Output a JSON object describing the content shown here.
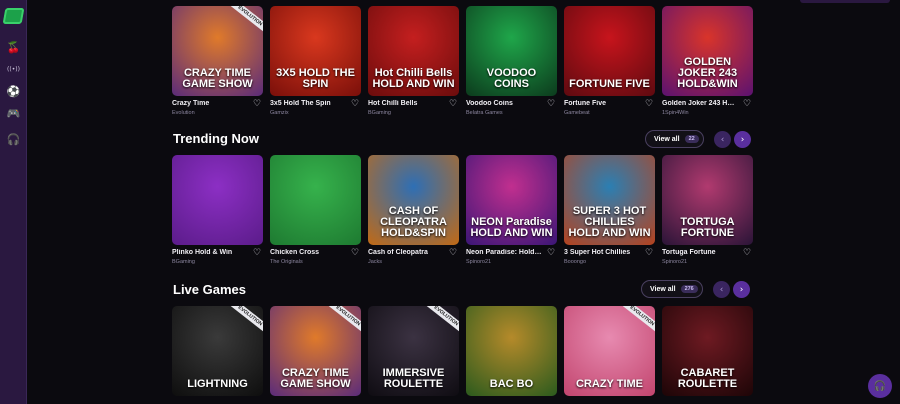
{
  "nav": {
    "icons": [
      "cherries-icon",
      "live-broadcast-icon",
      "soccer-ball-icon",
      "gamepad-icon",
      "headset-icon"
    ],
    "glyphs": [
      "🍒",
      "((•))",
      "⚽",
      "🎮",
      "🎧"
    ]
  },
  "sections": {
    "top": {
      "tiles": [
        {
          "title": "Crazy Time",
          "provider": "Evolution",
          "art": "CRAZY TIME GAME SHOW",
          "ribbon": "EVOLUTION",
          "bg1": "#e07a2a",
          "bg2": "#5a2b7a"
        },
        {
          "title": "3x5 Hold The Spin",
          "provider": "Gamzix",
          "art": "3X5 HOLD THE SPIN",
          "ribbon": "",
          "bg1": "#d9381e",
          "bg2": "#7a0f0a"
        },
        {
          "title": "Hot Chilli Bells",
          "provider": "BGaming",
          "art": "Hot Chilli Bells HOLD AND WIN",
          "ribbon": "",
          "bg1": "#c41f1f",
          "bg2": "#6b0c0c"
        },
        {
          "title": "Voodoo Coins",
          "provider": "Belatra Games",
          "art": "VOODOO COINS",
          "ribbon": "",
          "bg1": "#1fa64a",
          "bg2": "#0c3b1d"
        },
        {
          "title": "Fortune Five",
          "provider": "Gamebeat",
          "art": "FORTUNE FIVE",
          "ribbon": "",
          "bg1": "#c7141c",
          "bg2": "#5e0a10"
        },
        {
          "title": "Golden Joker 243 Hol…",
          "provider": "1Spin4Win",
          "art": "GOLDEN JOKER 243 HOLD&WIN",
          "ribbon": "",
          "bg1": "#d9342a",
          "bg2": "#5b1270"
        }
      ]
    },
    "trending": {
      "heading": "Trending Now",
      "view_all": "View all",
      "count": "22",
      "tiles": [
        {
          "title": "Plinko Hold & Win",
          "provider": "BGaming",
          "art": "",
          "ribbon": "",
          "bg1": "#8c2fc4",
          "bg2": "#5b1c8a"
        },
        {
          "title": "Chicken Cross",
          "provider": "The Originals",
          "art": "",
          "ribbon": "",
          "bg1": "#36b24c",
          "bg2": "#1e7a31"
        },
        {
          "title": "Cash of Cleopatra",
          "provider": "Jacks",
          "art": "CASH OF CLEOPATRA HOLD&SPIN",
          "ribbon": "",
          "bg1": "#2e6fb5",
          "bg2": "#c26a15"
        },
        {
          "title": "Neon Paradise: Hold a…",
          "provider": "Spinoro21",
          "art": "NEON Paradise HOLD AND WIN",
          "ribbon": "",
          "bg1": "#c12f8f",
          "bg2": "#3b1676"
        },
        {
          "title": "3 Super Hot Chillies",
          "provider": "Booongo",
          "art": "SUPER 3 HOT CHILLIES HOLD AND WIN",
          "ribbon": "",
          "bg1": "#2b7fb3",
          "bg2": "#b5421e"
        },
        {
          "title": "Tortuga Fortune",
          "provider": "Spinoro21",
          "art": "TORTUGA FORTUNE",
          "ribbon": "",
          "bg1": "#b13a6f",
          "bg2": "#2a1437"
        }
      ]
    },
    "live": {
      "heading": "Live Games",
      "view_all": "View all",
      "count": "276",
      "tiles": [
        {
          "title": "",
          "provider": "",
          "art": "LIGHTNING",
          "ribbon": "EVOLUTION",
          "bg1": "#3a3a3a",
          "bg2": "#0e0e0e"
        },
        {
          "title": "",
          "provider": "",
          "art": "CRAZY TIME GAME SHOW",
          "ribbon": "EVOLUTION",
          "bg1": "#e07a2a",
          "bg2": "#5a2b7a"
        },
        {
          "title": "",
          "provider": "",
          "art": "IMMERSIVE ROULETTE",
          "ribbon": "EVOLUTION",
          "bg1": "#3b3242",
          "bg2": "#0f0c12"
        },
        {
          "title": "",
          "provider": "",
          "art": "BAC BO",
          "ribbon": "",
          "bg1": "#b58a2a",
          "bg2": "#2b5a1d"
        },
        {
          "title": "",
          "provider": "",
          "art": "CRAZY TIME",
          "ribbon": "EVOLUTION",
          "bg1": "#e78ab0",
          "bg2": "#c2456e"
        },
        {
          "title": "",
          "provider": "",
          "art": "CABARET ROULETTE",
          "ribbon": "",
          "bg1": "#6e1a22",
          "bg2": "#1d0507"
        }
      ]
    }
  },
  "colors": {
    "accent": "#5a2f9e",
    "sidebar": "#2a1840",
    "page": "#0b0a0f"
  }
}
